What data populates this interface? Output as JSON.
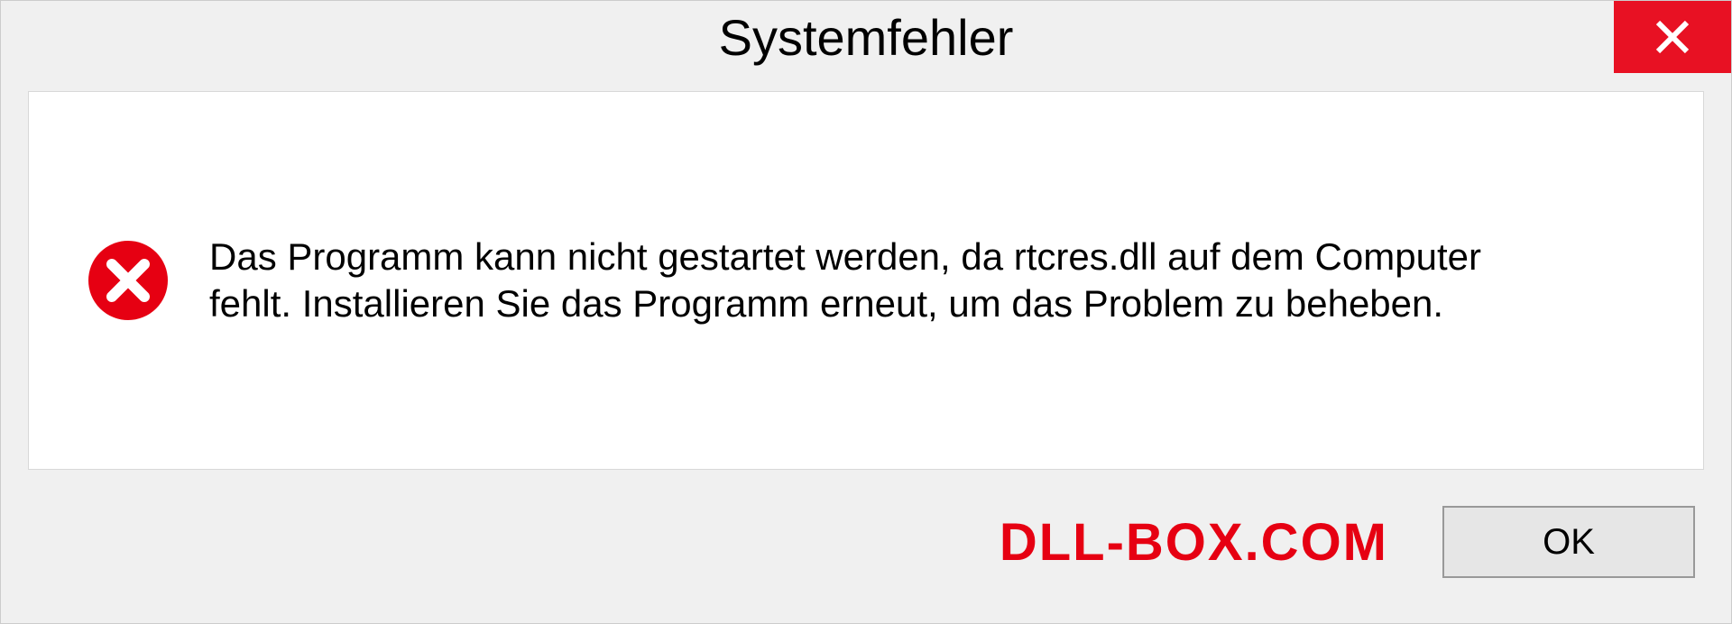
{
  "dialog": {
    "title": "Systemfehler",
    "message": "Das Programm kann nicht gestartet werden, da rtcres.dll auf dem Computer fehlt. Installieren Sie das Programm erneut, um das Problem zu beheben.",
    "ok_label": "OK"
  },
  "watermark": "DLL-BOX.COM",
  "colors": {
    "close_bg": "#e81123",
    "error_red": "#e60012",
    "watermark_red": "#e60012"
  }
}
